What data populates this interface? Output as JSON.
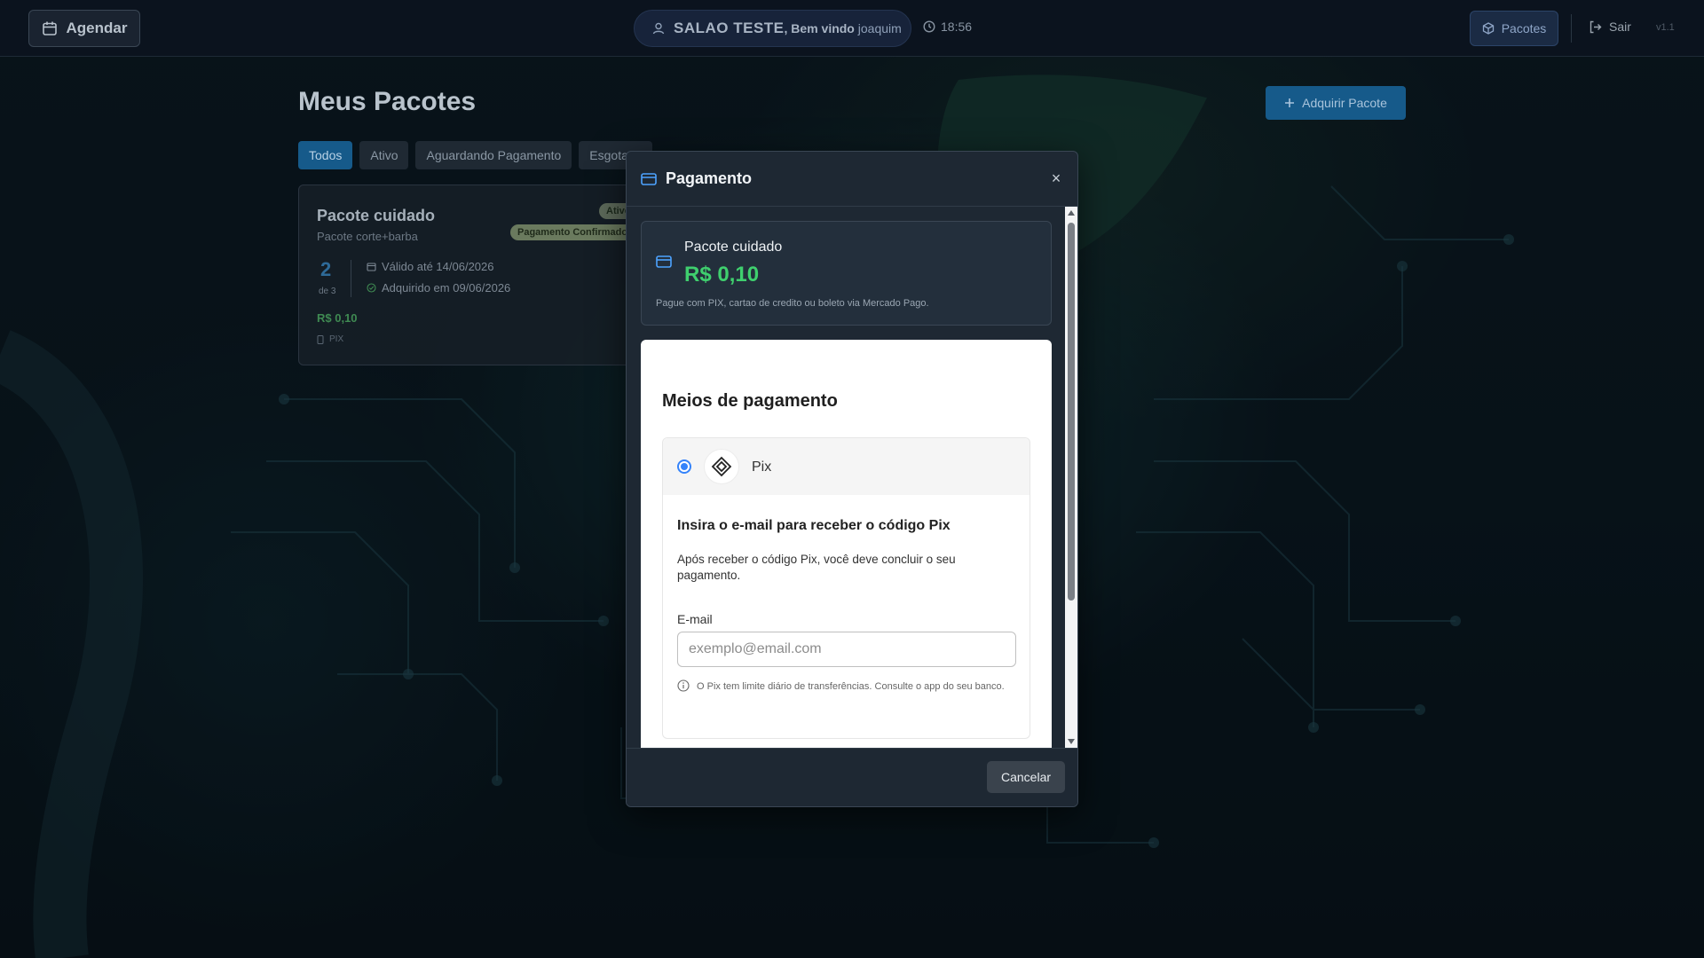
{
  "topbar": {
    "agendar_label": "Agendar",
    "salao_name": "SALAO TESTE",
    "welcome_prefix": ", Bem vindo",
    "username": "joaquim",
    "time": "18:56",
    "pacotes_label": "Pacotes",
    "sair_label": "Sair",
    "version": "v1.1"
  },
  "page": {
    "title": "Meus Pacotes",
    "adquirir_label": "Adquirir Pacote",
    "filters": [
      {
        "label": "Todos",
        "active": true
      },
      {
        "label": "Ativo",
        "active": false
      },
      {
        "label": "Aguardando Pagamento",
        "active": false
      },
      {
        "label": "Esgotado",
        "active": false
      }
    ]
  },
  "card": {
    "title": "Pacote cuidado",
    "subtitle": "Pacote corte+barba",
    "badge_status": "Ativo",
    "badge_payment": "Pagamento Confirmado",
    "used_count": "2",
    "total_label": "de 3",
    "valid_until": "Válido até 14/06/2026",
    "acquired_on": "Adquirido em 09/06/2026",
    "price": "R$ 0,10",
    "method": "PIX"
  },
  "modal": {
    "title": "Pagamento",
    "close_label": "×",
    "summary": {
      "name": "Pacote cuidado",
      "amount": "R$ 0,10",
      "description": "Pague com PIX, cartao de credito ou boleto via Mercado Pago."
    },
    "payment": {
      "heading": "Meios de pagamento",
      "option_label": "Pix",
      "option_selected": true,
      "pix_title": "Insira o e-mail para receber o código Pix",
      "pix_help": "Após receber o código Pix, você deve concluir o seu pagamento.",
      "email_label": "E-mail",
      "email_value": "",
      "email_placeholder": "exemplo@email.com",
      "note": "O Pix tem limite diário de transferências. Consulte o app do seu banco."
    },
    "cancel_label": "Cancelar"
  },
  "colors": {
    "accent": "#165a8a",
    "price_green": "#3fcf6e",
    "radio_blue": "#3483fa",
    "modal_bg": "#1e2833"
  }
}
